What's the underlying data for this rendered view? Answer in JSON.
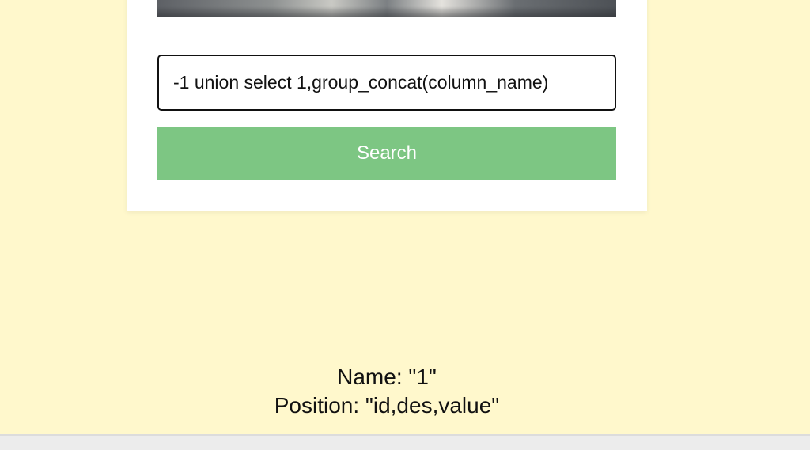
{
  "search": {
    "value": "-1 union select 1,group_concat(column_name)",
    "button_label": "Search"
  },
  "results": {
    "name_label": "Name: ",
    "name_value": "\"1\"",
    "position_label": "Position: ",
    "position_value": "\"id,des,value\""
  },
  "colors": {
    "page_background": "#fff8cc",
    "button_background": "#7dc683",
    "button_text": "#ffffff"
  }
}
